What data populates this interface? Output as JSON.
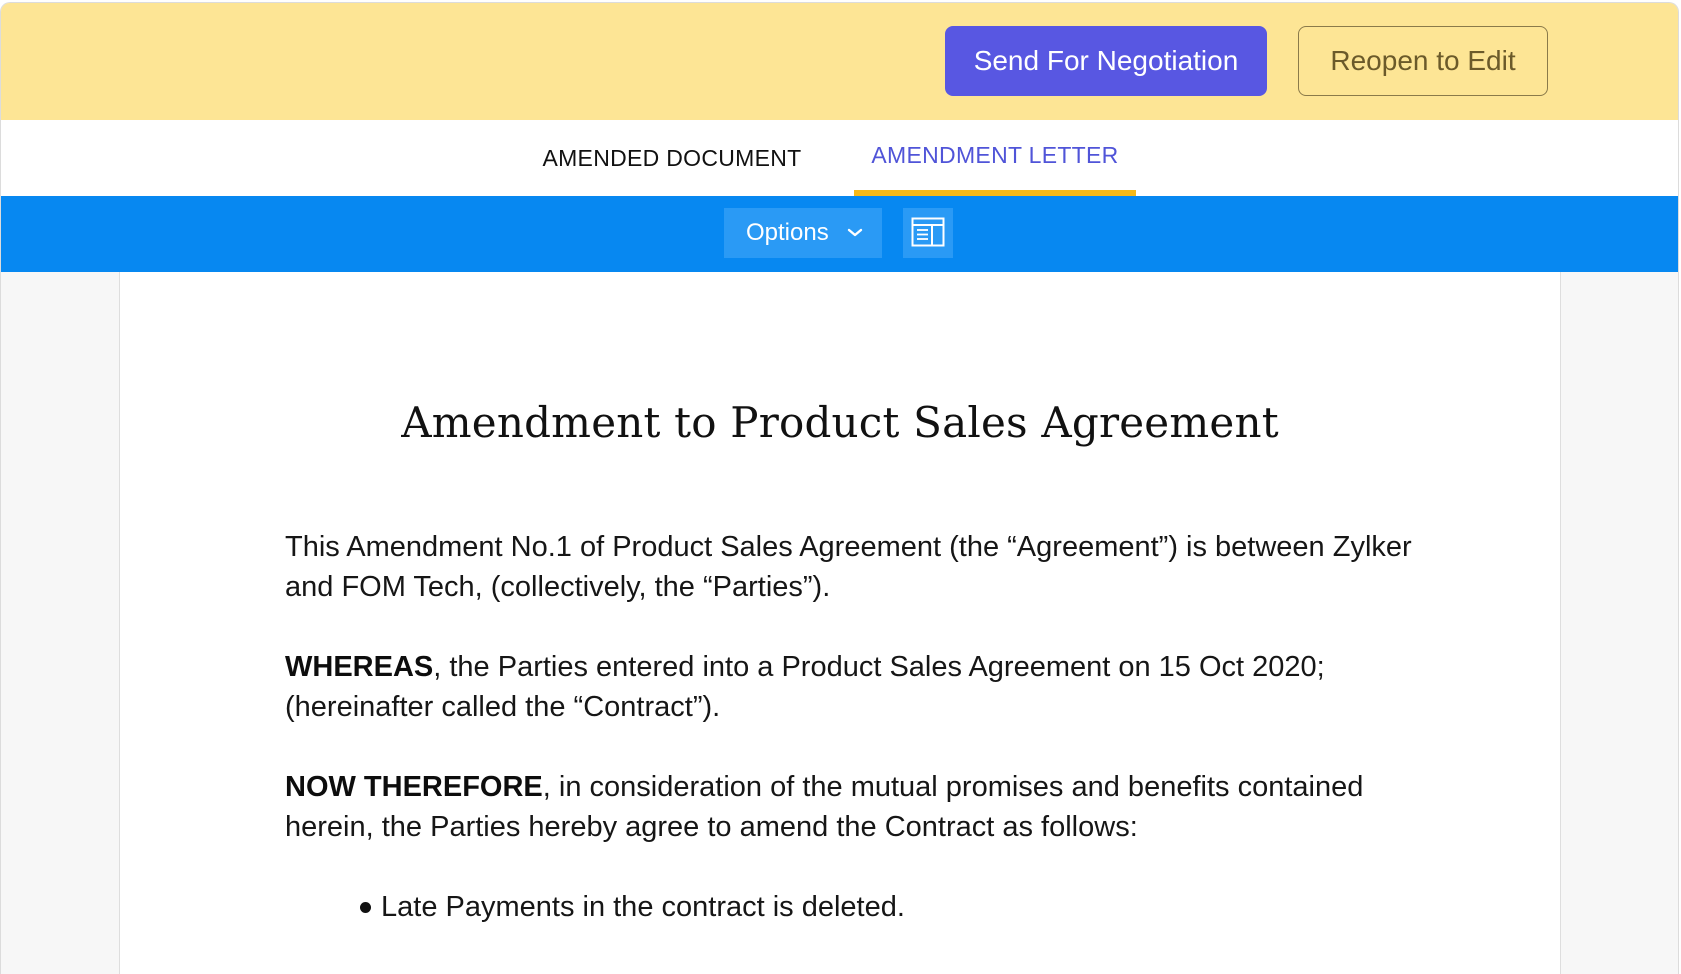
{
  "action_bar": {
    "send_label": "Send For Negotiation",
    "reopen_label": "Reopen to Edit"
  },
  "tabs": [
    {
      "label": "AMENDED DOCUMENT",
      "active": false
    },
    {
      "label": "AMENDMENT LETTER",
      "active": true
    }
  ],
  "toolbar": {
    "options_label": "Options",
    "options_icon": "chevron-down-icon",
    "layout_icon": "layout-view-icon"
  },
  "document": {
    "title": "Amendment to Product Sales Agreement",
    "para1": "This Amendment No.1 of Product Sales Agreement (the “Agreement”) is between Zylker and FOM Tech, (collectively, the “Parties”).",
    "para2_bold": "WHEREAS",
    "para2_rest": ", the Parties entered into a Product Sales Agreement on 15 Oct 2020; (hereinafter called the “Contract”).",
    "para3_bold": "NOW THEREFORE",
    "para3_rest": ", in consideration of the mutual promises and benefits contained herein, the Parties hereby agree to amend the Contract as follows:",
    "bullets": [
      "Late Payments in the contract is deleted."
    ]
  },
  "colors": {
    "action_bar_bg": "#fde595",
    "primary_button": "#5857e2",
    "active_tab_text": "#5054d8",
    "active_tab_underline": "#f7b918",
    "toolbar_bg": "#0788f1"
  }
}
